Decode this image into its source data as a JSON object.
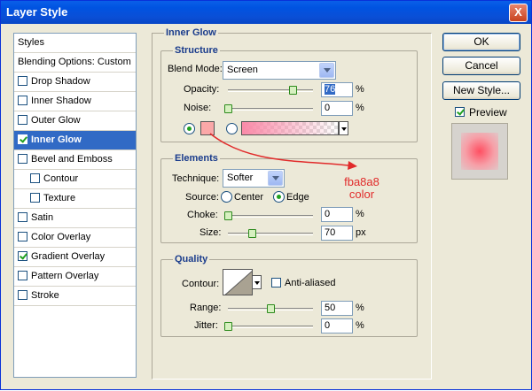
{
  "window": {
    "title": "Layer Style",
    "close_glyph": "X"
  },
  "styles_panel": {
    "header": "Styles",
    "blending_options": "Blending Options: Custom",
    "items": [
      {
        "label": "Drop Shadow",
        "checked": false
      },
      {
        "label": "Inner Shadow",
        "checked": false
      },
      {
        "label": "Outer Glow",
        "checked": false
      },
      {
        "label": "Inner Glow",
        "checked": true,
        "selected": true
      },
      {
        "label": "Bevel and Emboss",
        "checked": false
      },
      {
        "label": "Contour",
        "checked": false
      },
      {
        "label": "Texture",
        "checked": false
      },
      {
        "label": "Satin",
        "checked": false
      },
      {
        "label": "Color Overlay",
        "checked": false
      },
      {
        "label": "Gradient Overlay",
        "checked": true
      },
      {
        "label": "Pattern Overlay",
        "checked": false
      },
      {
        "label": "Stroke",
        "checked": false
      }
    ]
  },
  "inner_glow": {
    "title": "Inner Glow",
    "structure": {
      "title": "Structure",
      "blend_mode_label": "Blend Mode:",
      "blend_mode_value": "Screen",
      "opacity_label": "Opacity:",
      "opacity_value": "76",
      "opacity_unit": "%",
      "opacity_level": 0.76,
      "noise_label": "Noise:",
      "noise_value": "0",
      "noise_unit": "%",
      "noise_level": 0,
      "glow_color": "#fba8a8",
      "color_mode": "solid"
    },
    "elements": {
      "title": "Elements",
      "technique_label": "Technique:",
      "technique_value": "Softer",
      "source_label": "Source:",
      "source_center_label": "Center",
      "source_edge_label": "Edge",
      "source_selected": "Edge",
      "choke_label": "Choke:",
      "choke_value": "0",
      "choke_unit": "%",
      "choke_level": 0,
      "size_label": "Size:",
      "size_value": "70",
      "size_unit": "px",
      "size_level": 0.28
    },
    "quality": {
      "title": "Quality",
      "contour_label": "Contour:",
      "anti_aliased_label": "Anti-aliased",
      "anti_aliased_checked": false,
      "range_label": "Range:",
      "range_value": "50",
      "range_unit": "%",
      "range_level": 0.5,
      "jitter_label": "Jitter:",
      "jitter_value": "0",
      "jitter_unit": "%",
      "jitter_level": 0
    }
  },
  "buttons": {
    "ok": "OK",
    "cancel": "Cancel",
    "new_style": "New Style...",
    "preview_label": "Preview",
    "preview_checked": true
  },
  "annotation": {
    "line1": "fba8a8",
    "line2": "color",
    "color": "#e12b2b"
  }
}
